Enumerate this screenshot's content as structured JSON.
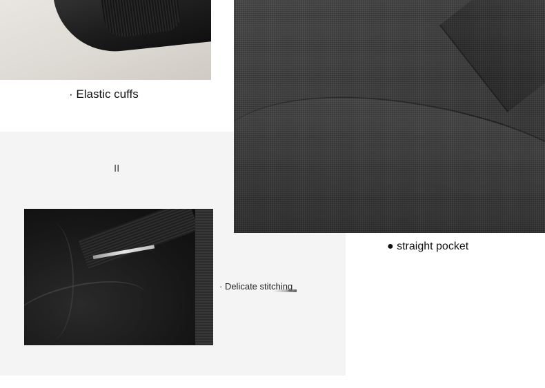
{
  "captions": {
    "cuffs": "· Elastic cuffs",
    "decor": "II",
    "pocket": "● straight pocket",
    "stitching": "· Delicate stitching"
  },
  "colors": {
    "background": "#ffffff",
    "panel": "#f4f4f4",
    "fabric": "#3f3f3f",
    "text": "#111111"
  }
}
